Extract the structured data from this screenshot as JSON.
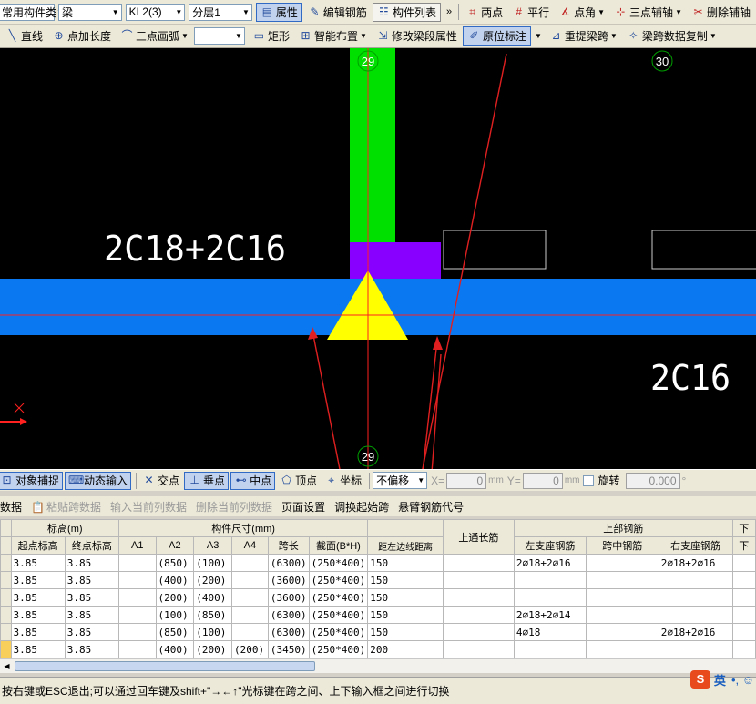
{
  "toolbar1": {
    "component_type_combo": "常用构件类",
    "component_combo": "梁",
    "name_combo": "KL2(3)",
    "layer_combo": "分层1",
    "btn_properties": "属性",
    "btn_edit_rebar": "编辑钢筋",
    "btn_component_list": "构件列表",
    "btn_two_points": "两点",
    "btn_parallel": "平行",
    "btn_point_angle": "点角",
    "btn_three_point_axis": "三点辅轴",
    "btn_delete_axis": "删除辅轴"
  },
  "toolbar2": {
    "btn_line": "直线",
    "btn_point_length": "点加长度",
    "btn_three_point_arc": "三点画弧",
    "btn_rect": "矩形",
    "btn_smart_layout": "智能布置",
    "btn_modify_span": "修改梁段属性",
    "btn_in_place_label": "原位标注",
    "btn_re_extract_span": "重提梁跨",
    "btn_copy_span_data": "梁跨数据复制"
  },
  "canvas": {
    "axis_label_top_left": "29",
    "axis_label_top_right": "30",
    "axis_label_bottom": "29",
    "rebar_label_left": "2C18+2C16",
    "rebar_label_right": "2C16",
    "colors": {
      "column_green": "#00e000",
      "column_purple": "#8800ff",
      "beam_blue": "#0a78f0",
      "support_yellow": "#ffff00",
      "axis_red": "#ff2020",
      "annotation_red": "#e02020"
    }
  },
  "snapbar": {
    "btn_object_snap": "对象捕捉",
    "btn_dynamic_input": "动态输入",
    "btn_intersection": "交点",
    "btn_perpendicular": "垂点",
    "btn_midpoint": "中点",
    "btn_vertex": "顶点",
    "btn_coordinate": "坐标",
    "offset_combo": "不偏移",
    "x_label": "X=",
    "x_value": "0",
    "x_unit": "mm",
    "y_label": "Y=",
    "y_value": "0",
    "y_unit": "mm",
    "rotate_label": "旋转",
    "rotate_value": "0.000",
    "rotate_unit": "°"
  },
  "table_toolbar": {
    "btn_copy_data": "数据",
    "btn_paste_span": "粘贴跨数据",
    "btn_input_current_col": "输入当前列数据",
    "btn_delete_current_col": "删除当前列数据",
    "btn_page_setup": "页面设置",
    "btn_swap_start": "调换起始跨",
    "btn_cantilever_code": "悬臂钢筋代号"
  },
  "table": {
    "group_headers": {
      "elevation": "标高(m)",
      "dimensions": "构件尺寸(mm)",
      "top_through": "上通长筋",
      "top_rebar": "上部钢筋",
      "next": "下"
    },
    "columns": [
      "起点标高",
      "终点标高",
      "A1",
      "A2",
      "A3",
      "A4",
      "跨长",
      "截面(B*H)",
      "距左边线距离",
      "",
      "左支座钢筋",
      "跨中钢筋",
      "右支座钢筋",
      "下"
    ],
    "rows": [
      [
        "3.85",
        "3.85",
        "",
        "(850)",
        "(100)",
        "",
        "(6300)",
        "(250*400)",
        "150",
        "",
        "2⌀18+2⌀16",
        "",
        "2⌀18+2⌀16",
        ""
      ],
      [
        "3.85",
        "3.85",
        "",
        "(400)",
        "(200)",
        "",
        "(3600)",
        "(250*400)",
        "150",
        "",
        "",
        "",
        "",
        ""
      ],
      [
        "3.85",
        "3.85",
        "",
        "(200)",
        "(400)",
        "",
        "(3600)",
        "(250*400)",
        "150",
        "",
        "",
        "",
        "",
        ""
      ],
      [
        "3.85",
        "3.85",
        "",
        "(100)",
        "(850)",
        "",
        "(6300)",
        "(250*400)",
        "150",
        "",
        "2⌀18+2⌀14",
        "",
        "",
        ""
      ],
      [
        "3.85",
        "3.85",
        "",
        "(850)",
        "(100)",
        "",
        "(6300)",
        "(250*400)",
        "150",
        "",
        "4⌀18",
        "",
        "2⌀18+2⌀16",
        ""
      ],
      [
        "3.85",
        "3.85",
        "",
        "(400)",
        "(200)",
        "(200)",
        "(3450)",
        "(250*400)",
        "200",
        "",
        "",
        "",
        "",
        ""
      ]
    ]
  },
  "status": {
    "text": "按右键或ESC退出;可以通过回车键及shift+\"→←↑\"光标键在跨之间、上下输入框之间进行切换",
    "ime_logo": "S",
    "ime_lang": "英",
    "ime_extra": "•, ☺"
  }
}
